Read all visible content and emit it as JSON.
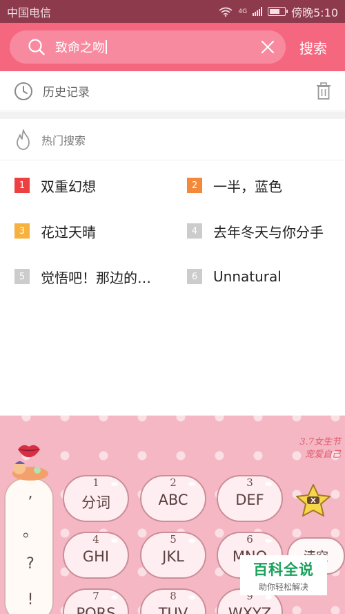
{
  "status_bar": {
    "carrier": "中国电信",
    "network": "4G",
    "time_text": "傍晚5:10"
  },
  "search": {
    "query": "致命之吻",
    "submit_label": "搜索"
  },
  "history": {
    "label": "历史记录"
  },
  "hot": {
    "title": "热门搜索",
    "items": [
      {
        "rank": "1",
        "text": "双重幻想",
        "color": "#ee4040"
      },
      {
        "rank": "2",
        "text": "一半，蓝色",
        "color": "#f5893a"
      },
      {
        "rank": "3",
        "text": "花过天晴",
        "color": "#f6b23d"
      },
      {
        "rank": "4",
        "text": "去年冬天与你分手",
        "color": "#cccccc"
      },
      {
        "rank": "5",
        "text": "觉悟吧！那边的…",
        "color": "#cccccc"
      },
      {
        "rank": "6",
        "text": "Unnatural",
        "color": "#cccccc"
      }
    ]
  },
  "keyboard": {
    "top_note_line1": "3.7女生节",
    "top_note_line2": "宠爱自己",
    "punctuation": [
      ",",
      "。",
      "?",
      "!"
    ],
    "keys": [
      {
        "num": "1",
        "letters": "分词"
      },
      {
        "num": "2",
        "letters": "ABC"
      },
      {
        "num": "3",
        "letters": "DEF"
      },
      {
        "num": "4",
        "letters": "GHI"
      },
      {
        "num": "5",
        "letters": "JKL"
      },
      {
        "num": "6",
        "letters": "MNO"
      },
      {
        "num": "7",
        "letters": "PQRS"
      },
      {
        "num": "8",
        "letters": "TUV"
      },
      {
        "num": "9",
        "letters": "WXYZ"
      }
    ],
    "side_key_label": "清空"
  },
  "watermark": {
    "title": "百科全说",
    "subtitle": "助你轻松解决"
  }
}
